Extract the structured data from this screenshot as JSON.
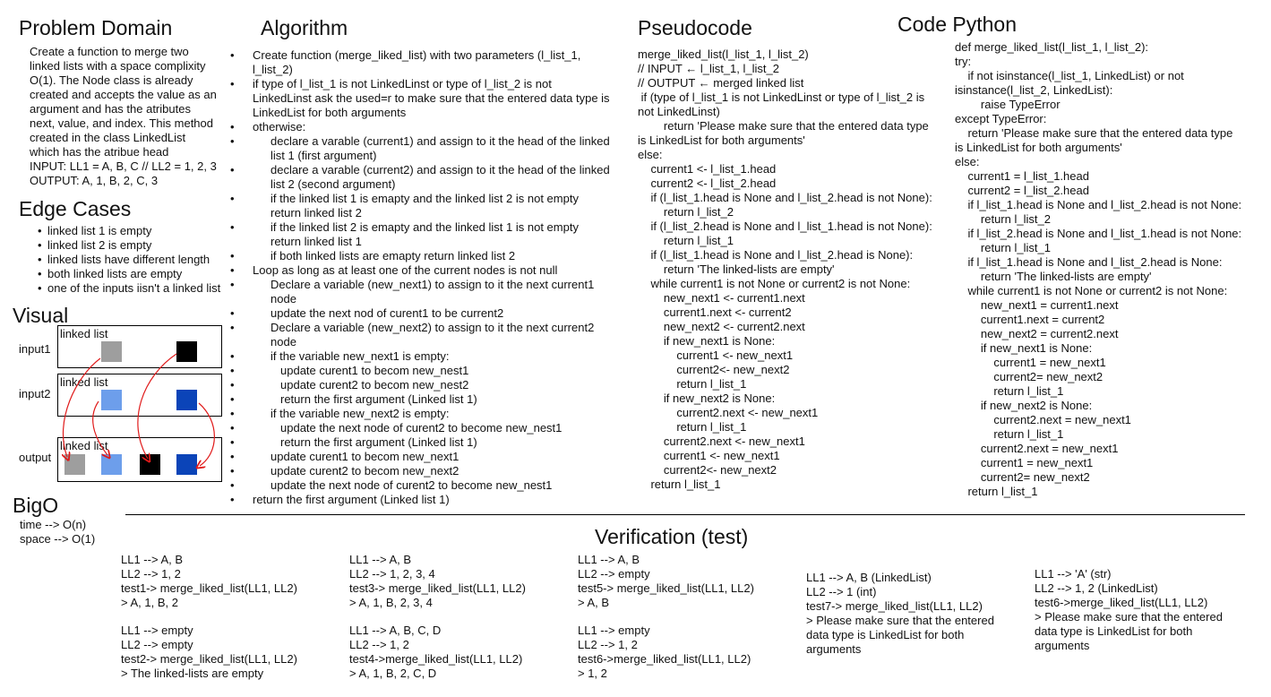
{
  "problem": {
    "title": "Problem Domain",
    "lines": [
      "Create a function to merge two",
      "linked lists with a space complixity",
      "O(1). The Node class is already",
      "created and accepts the value as an",
      "argument and has the atributes",
      "next, value, and index. This method",
      "created in the class LinkedList",
      "which has the atribue head",
      "INPUT: LL1 = A, B, C // LL2 = 1, 2, 3",
      "OUTPUT: A, 1, B, 2, C, 3"
    ]
  },
  "edge": {
    "title": "Edge Cases",
    "items": [
      "linked list 1 is empty",
      "linked list 2 is empty",
      "linked lists have different length",
      "both linked lists are empty",
      "one of the inputs iisn't a linked list"
    ]
  },
  "visual": {
    "title": "Visual",
    "rows": [
      {
        "label": "input1",
        "caption": "linked list"
      },
      {
        "label": "input2",
        "caption": "linked list"
      },
      {
        "label": "output",
        "caption": "linked list"
      }
    ],
    "colors": {
      "gray": "#9e9e9e",
      "light_blue": "#6d9eeb",
      "black": "#000000",
      "dark_blue": "#0b44b8",
      "arrow": "#e01b1b"
    }
  },
  "bigo": {
    "title": "BigO",
    "time": "time --> O(n)",
    "space": "space --> O(1)"
  },
  "algorithm": {
    "title": "Algorithm",
    "items": [
      {
        "level": 1,
        "text": "Create function (merge_liked_list) with two parameters (l_list_1, l_list_2)"
      },
      {
        "level": 1,
        "text": "if type of l_list_1 is not LinkedLinst or type of l_list_2 is not LinkedLinst ask the used=r to make sure that the entered data type is LinkedList for both arguments"
      },
      {
        "level": 1,
        "text": "otherwise:"
      },
      {
        "level": 2,
        "text": "declare a varable (current1) and assign to it the head of the linked list 1 (first argument)"
      },
      {
        "level": 2,
        "text": "declare a varable (current2) and assign to it the head of the linked list 2 (second argument)"
      },
      {
        "level": 2,
        "text": "if the linked list 1 is emapty and the linked list 2 is not empty return linked list 2"
      },
      {
        "level": 2,
        "text": "if the linked list 2 is emapty and the linked list 1 is not empty return linked list 1"
      },
      {
        "level": 2,
        "text": "if both linked lists are emapty return linked list 2"
      },
      {
        "level": 1,
        "text": "Loop as long as at least one of the current nodes is not null"
      },
      {
        "level": 2,
        "text": "Declare a variable (new_next1) to assign to it the next current1 node"
      },
      {
        "level": 2,
        "text": "update the next nod of curent1 to be current2"
      },
      {
        "level": 2,
        "text": "Declare a variable (new_next2) to assign to it the next current2 node"
      },
      {
        "level": 2,
        "text": "if the variable new_next1 is empty:"
      },
      {
        "level": 3,
        "text": "update curent1 to becom new_nest1"
      },
      {
        "level": 3,
        "text": "update curent2 to becom new_nest2"
      },
      {
        "level": 3,
        "text": "return the first argument (Linked list 1)"
      },
      {
        "level": 2,
        "text": "if the variable new_next2 is empty:"
      },
      {
        "level": 3,
        "text": "update the next node of curent2 to become new_nest1"
      },
      {
        "level": 3,
        "text": "return the first argument (Linked list 1)"
      },
      {
        "level": 2,
        "text": "update curent1 to becom new_next1"
      },
      {
        "level": 2,
        "text": "update curent2 to becom new_next2"
      },
      {
        "level": 2,
        "text": "update the next node of curent2 to become new_nest1"
      },
      {
        "level": 1,
        "text": "return the first argument (Linked list 1)"
      }
    ]
  },
  "pseudocode": {
    "title": "Pseudocode",
    "lines": [
      "merge_liked_list(l_list_1, l_list_2)",
      "// INPUT ← l_list_1, l_list_2",
      "// OUTPUT ← merged linked list",
      " if (type of l_list_1 is not LinkedLinst or type of l_list_2 is",
      "not LinkedLinst)",
      "        return 'Please make sure that the entered data type",
      "is LinkedList for both arguments'",
      "else:",
      "    current1 <- l_list_1.head",
      "    current2 <- l_list_2.head",
      "    if (l_list_1.head is None and l_list_2.head is not None):",
      "        return l_list_2",
      "    if (l_list_2.head is None and l_list_1.head is not None):",
      "        return l_list_1",
      "    if (l_list_1.head is None and l_list_2.head is None):",
      "        return 'The linked-lists are empty'",
      "    while current1 is not None or current2 is not None:",
      "        new_next1 <- current1.next",
      "        current1.next <- current2",
      "        new_next2 <- current2.next",
      "        if new_next1 is None:",
      "            current1 <- new_next1",
      "            current2<- new_next2",
      "            return l_list_1",
      "        if new_next2 is None:",
      "            current2.next <- new_next1",
      "            return l_list_1",
      "        current2.next <- new_next1",
      "        current1 <- new_next1",
      "        current2<- new_next2",
      "    return l_list_1"
    ]
  },
  "python": {
    "title": "Code Python",
    "lines": [
      "def merge_liked_list(l_list_1, l_list_2):",
      "try:",
      "    if not isinstance(l_list_1, LinkedList) or not",
      "isinstance(l_list_2, LinkedList):",
      "        raise TypeError",
      "except TypeError:",
      "    return 'Please make sure that the entered data type",
      "is LinkedList for both arguments'",
      "else:",
      "    current1 = l_list_1.head",
      "    current2 = l_list_2.head",
      "    if l_list_1.head is None and l_list_2.head is not None:",
      "        return l_list_2",
      "    if l_list_2.head is None and l_list_1.head is not None:",
      "        return l_list_1",
      "    if l_list_1.head is None and l_list_2.head is None:",
      "        return 'The linked-lists are empty'",
      "    while current1 is not None or current2 is not None:",
      "        new_next1 = current1.next",
      "        current1.next = current2",
      "        new_next2 = current2.next",
      "        if new_next1 is None:",
      "            current1 = new_next1",
      "            current2= new_next2",
      "            return l_list_1",
      "        if new_next2 is None:",
      "            current2.next = new_next1",
      "            return l_list_1",
      "        current2.next = new_next1",
      "        current1 = new_next1",
      "        current2= new_next2",
      "    return l_list_1"
    ]
  },
  "verification": {
    "title": "Verification (test)",
    "tests": [
      [
        "LL1 --> A, B",
        "LL2 --> 1, 2",
        "test1-> merge_liked_list(LL1, LL2)",
        "> A, 1, B, 2"
      ],
      [
        "LL1 --> empty",
        "LL2 --> empty",
        "test2-> merge_liked_list(LL1, LL2)",
        "> The linked-lists are empty"
      ],
      [
        "LL1 --> A, B",
        "LL2 --> 1, 2, 3, 4",
        "test3-> merge_liked_list(LL1, LL2)",
        "> A, 1, B, 2, 3, 4"
      ],
      [
        "LL1 --> A, B, C, D",
        "LL2 --> 1, 2",
        "test4->merge_liked_list(LL1, LL2)",
        "> A, 1, B, 2, C, D"
      ],
      [
        "LL1 --> A, B",
        "LL2 --> empty",
        "test5-> merge_liked_list(LL1, LL2)",
        "> A, B"
      ],
      [
        "LL1 --> empty",
        "LL2 --> 1, 2",
        "test6->merge_liked_list(LL1, LL2)",
        "> 1, 2"
      ],
      [
        "LL1 --> A, B (LinkedList)",
        "LL2 --> 1 (int)",
        "test7-> merge_liked_list(LL1, LL2)",
        "> Please make sure that the entered",
        "data type is LinkedList for both",
        "arguments"
      ],
      [
        "LL1 --> 'A' (str)",
        "LL2 --> 1, 2 (LinkedList)",
        "test6->merge_liked_list(LL1, LL2)",
        "> Please make sure that the entered",
        "data type is LinkedList for both",
        "arguments"
      ]
    ]
  }
}
